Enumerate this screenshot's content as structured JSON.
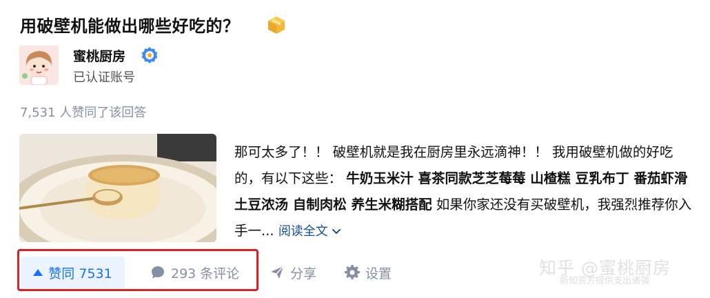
{
  "question": {
    "title": "用破壁机能做出哪些好吃的？"
  },
  "author": {
    "name": "蜜桃厨房",
    "description": "已认证账号"
  },
  "answer": {
    "vote_summary": "7,531 人赞同了该回答",
    "excerpt_parts": [
      {
        "text": "那可太多了！！ 破壁机就是我在厨房里永远滴神！！ 我用破壁机做的好吃的，有以下这些： ",
        "bold": false
      },
      {
        "text": "牛奶玉米汁 喜茶同款芝芝莓莓 山楂糕 豆乳布丁 番茄虾滑 土豆浓汤 自制肉松 养生米糊搭配",
        "bold": true
      },
      {
        "text": " 如果你家还没有买破壁机，我强烈推荐你入手一...",
        "bold": false
      }
    ],
    "read_more_label": "阅读全文"
  },
  "actions": {
    "vote_label": "赞同 7531",
    "comment_label": "293 条评论",
    "share_label": "分享",
    "settings_label": "设置"
  },
  "watermark": {
    "main": "知乎 @蜜桃厨房",
    "sub": "新知资方提供支出诸强"
  },
  "colors": {
    "accent": "#1772f6",
    "vote_bg": "#ebf3ff",
    "muted": "#8590a6",
    "link": "#175199",
    "highlight_frame": "#e02020"
  }
}
